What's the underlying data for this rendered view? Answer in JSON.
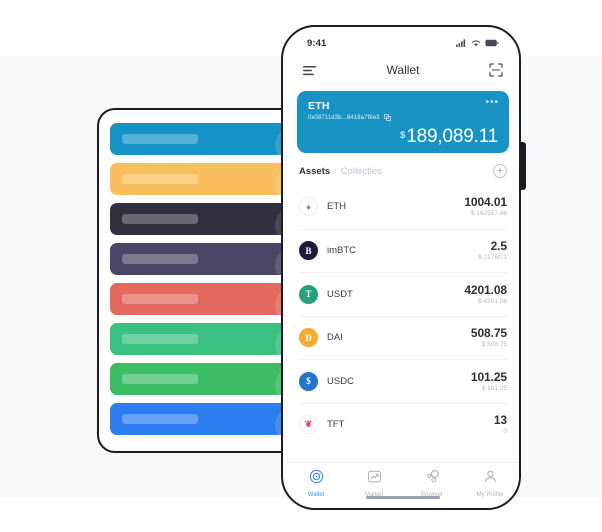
{
  "colors": {
    "page_background": "#ffffff",
    "band_background": "#f8f9fa",
    "frame": "#1c1c22",
    "card_blue": "#1893c4",
    "accent_blue": "#3b8cf5",
    "text_dark": "#32323c",
    "text_muted": "#b4b8c6"
  },
  "left_panel": {
    "name": "card-stack-placeholder",
    "cards": [
      {
        "color": "#1593c6",
        "coin_glyph": "♦",
        "coin_name": "eth-coin-icon"
      },
      {
        "color": "#f9bf5f",
        "coin_glyph": "B",
        "coin_name": "btc-coin-icon"
      },
      {
        "color": "#30303f",
        "coin_glyph": "✹",
        "coin_name": "star-coin-icon"
      },
      {
        "color": "#4b4566",
        "coin_glyph": "◆",
        "coin_name": "drop-coin-icon"
      },
      {
        "color": "#e4685d",
        "coin_glyph": "▷",
        "coin_name": "tron-coin-icon"
      },
      {
        "color": "#3ac17f",
        "coin_glyph": "N",
        "coin_name": "neo-coin-icon"
      },
      {
        "color": "#3cbc63",
        "coin_glyph": "B",
        "coin_name": "bch-coin-icon"
      },
      {
        "color": "#2b7df0",
        "coin_glyph": "Ł",
        "coin_name": "ltc-coin-icon"
      }
    ]
  },
  "phone": {
    "status_bar": {
      "time": "9:41",
      "signal_icon": "cellular-signal-icon",
      "wifi_icon": "wifi-icon",
      "battery_icon": "battery-icon"
    },
    "header": {
      "menu_icon": "menu-icon",
      "title": "Wallet",
      "scan_icon": "scan-qr-icon"
    },
    "balance_card": {
      "symbol": "ETH",
      "address": "0x08711d3b...8418a7f8e3",
      "copy_icon": "copy-icon",
      "more_icon": "more-options-icon",
      "currency": "$",
      "amount": "189,089.11"
    },
    "tabs": {
      "assets_label": "Assets",
      "separator": "/",
      "collectibles_label": "Collectles",
      "add_label": "+"
    },
    "assets": [
      {
        "symbol": "ETH",
        "amount": "1004.01",
        "fiat": "$ 162517.48",
        "icon_name": "eth-asset-icon",
        "icon_glyph": "♦",
        "icon_bg": "#ffffff",
        "icon_border": "#eceef4",
        "icon_color": "#6f7fd6"
      },
      {
        "symbol": "imBTC",
        "amount": "2.5",
        "fiat": "$ 21760.1",
        "icon_name": "imbtc-asset-icon",
        "icon_glyph": "B",
        "icon_bg": "#1b1b3a",
        "icon_border": "#1b1b3a",
        "icon_color": "#ffffff"
      },
      {
        "symbol": "USDT",
        "amount": "4201.08",
        "fiat": "$ 4201.08",
        "icon_name": "usdt-asset-icon",
        "icon_glyph": "T",
        "icon_bg": "#27a17c",
        "icon_border": "#27a17c",
        "icon_color": "#ffffff"
      },
      {
        "symbol": "DAI",
        "amount": "508.75",
        "fiat": "$ 508.75",
        "icon_name": "dai-asset-icon",
        "icon_glyph": "Đ",
        "icon_bg": "#f5ab2b",
        "icon_border": "#f5ab2b",
        "icon_color": "#ffffff"
      },
      {
        "symbol": "USDC",
        "amount": "101.25",
        "fiat": "$ 101.25",
        "icon_name": "usdc-asset-icon",
        "icon_glyph": "$",
        "icon_bg": "#2775ca",
        "icon_border": "#2775ca",
        "icon_color": "#ffffff"
      },
      {
        "symbol": "TFT",
        "amount": "13",
        "fiat": "0",
        "icon_name": "tft-asset-icon",
        "icon_glyph": "❦",
        "icon_bg": "#ffffff",
        "icon_border": "#f4eef0",
        "icon_color": "#e8415b"
      }
    ],
    "bottom_nav": [
      {
        "label": "Wallet",
        "icon_name": "wallet-nav-icon",
        "active": true
      },
      {
        "label": "Market",
        "icon_name": "market-nav-icon",
        "active": false
      },
      {
        "label": "Browser",
        "icon_name": "browser-nav-icon",
        "active": false
      },
      {
        "label": "My Profile",
        "icon_name": "profile-nav-icon",
        "active": false
      }
    ],
    "home_indicator": "home-indicator"
  }
}
